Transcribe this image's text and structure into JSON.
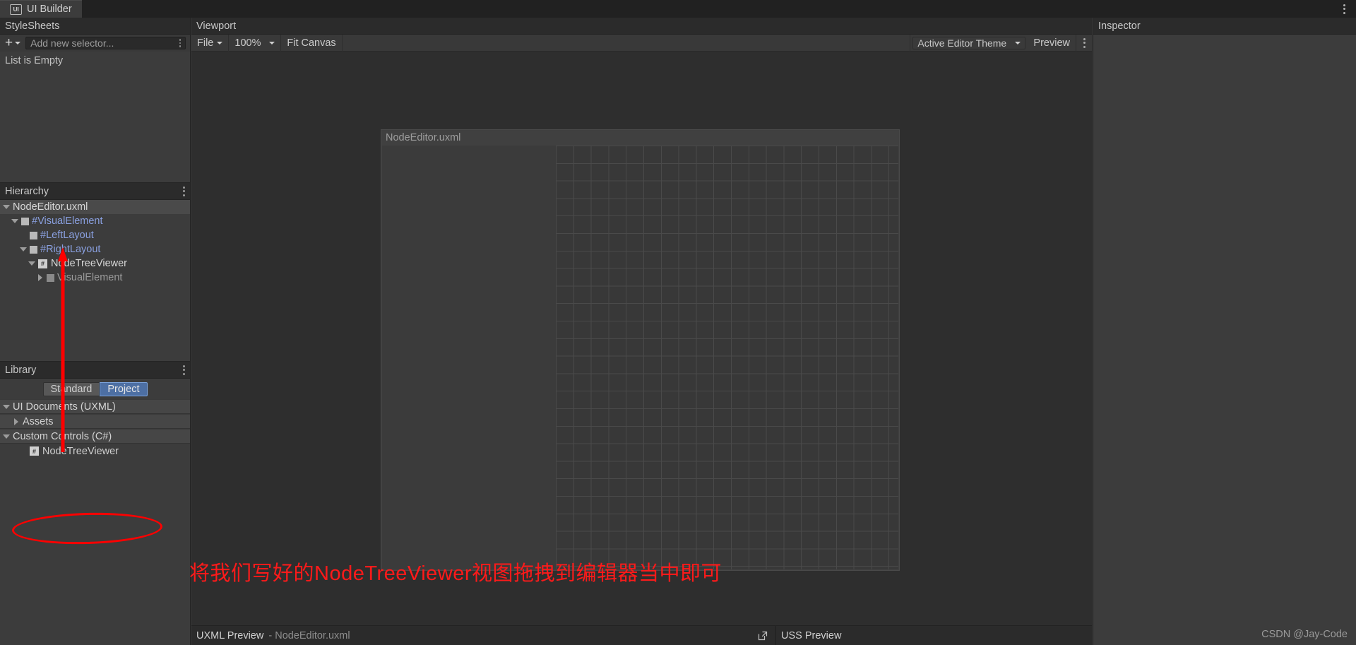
{
  "window": {
    "tab_title": "UI Builder",
    "tab_icon": "ui-builder-icon",
    "menu_icon": "kebab-menu-icon"
  },
  "stylesheets": {
    "header": "StyleSheets",
    "add_button_icon": "plus-icon",
    "add_dropdown_icon": "chevron-down-icon",
    "selector_placeholder": "Add new selector...",
    "selector_value": "",
    "field_menu_icon": "kebab-menu-icon",
    "empty_text": "List is Empty"
  },
  "hierarchy": {
    "header": "Hierarchy",
    "menu_icon": "kebab-menu-icon",
    "items": [
      {
        "label": "NodeEditor.uxml",
        "indent": 0,
        "twisty": "down",
        "icon": "none",
        "style": "white",
        "selected": true
      },
      {
        "label": "#VisualElement",
        "indent": 1,
        "twisty": "down",
        "icon": "element-box",
        "style": "blue",
        "selected": false
      },
      {
        "label": "#LeftLayout",
        "indent": 2,
        "twisty": "none",
        "icon": "element-box",
        "style": "blue",
        "selected": false
      },
      {
        "label": "#RightLayout",
        "indent": 2,
        "twisty": "down",
        "icon": "element-box",
        "style": "blue",
        "selected": false
      },
      {
        "label": "NodeTreeViewer",
        "indent": 3,
        "twisty": "down",
        "icon": "custom-control-box",
        "style": "white",
        "selected": false
      },
      {
        "label": "VisualElement",
        "indent": 4,
        "twisty": "right",
        "icon": "element-box-dim",
        "style": "grey",
        "selected": false
      }
    ]
  },
  "library": {
    "header": "Library",
    "menu_icon": "kebab-menu-icon",
    "tabs": [
      {
        "label": "Standard",
        "active": false
      },
      {
        "label": "Project",
        "active": true
      }
    ],
    "groups": [
      {
        "label": "UI Documents (UXML)",
        "twisty": "down",
        "indent": 0,
        "type": "group"
      },
      {
        "label": "Assets",
        "twisty": "right",
        "indent": 1,
        "type": "group"
      },
      {
        "label": "Custom Controls (C#)",
        "twisty": "down",
        "indent": 0,
        "type": "group"
      }
    ],
    "item": {
      "label": "NodeTreeViewer",
      "icon": "custom-control-box"
    }
  },
  "viewport": {
    "header": "Viewport",
    "file_menu": "File",
    "file_menu_icon": "chevron-down-icon",
    "zoom_level": "100%",
    "zoom_icon": "chevron-down-icon",
    "fit_canvas": "Fit Canvas",
    "theme_value": "Active Editor Theme",
    "theme_icon": "chevron-down-icon",
    "preview_button": "Preview",
    "menu_icon": "kebab-menu-icon",
    "canvas_title": "NodeEditor.uxml"
  },
  "previews": {
    "uxml_label": "UXML Preview",
    "uxml_file": "- NodeEditor.uxml",
    "uxml_open_icon": "open-external-icon",
    "uss_label": "USS Preview"
  },
  "inspector": {
    "header": "Inspector"
  },
  "annotations": {
    "note_text": "将我们写好的NodeTreeViewer视图拖拽到编辑器当中即可",
    "arrow_icon": "red-arrow-up",
    "ellipse_icon": "red-ellipse-highlight",
    "color": "#ff0000"
  },
  "watermark": "CSDN @Jay-Code"
}
